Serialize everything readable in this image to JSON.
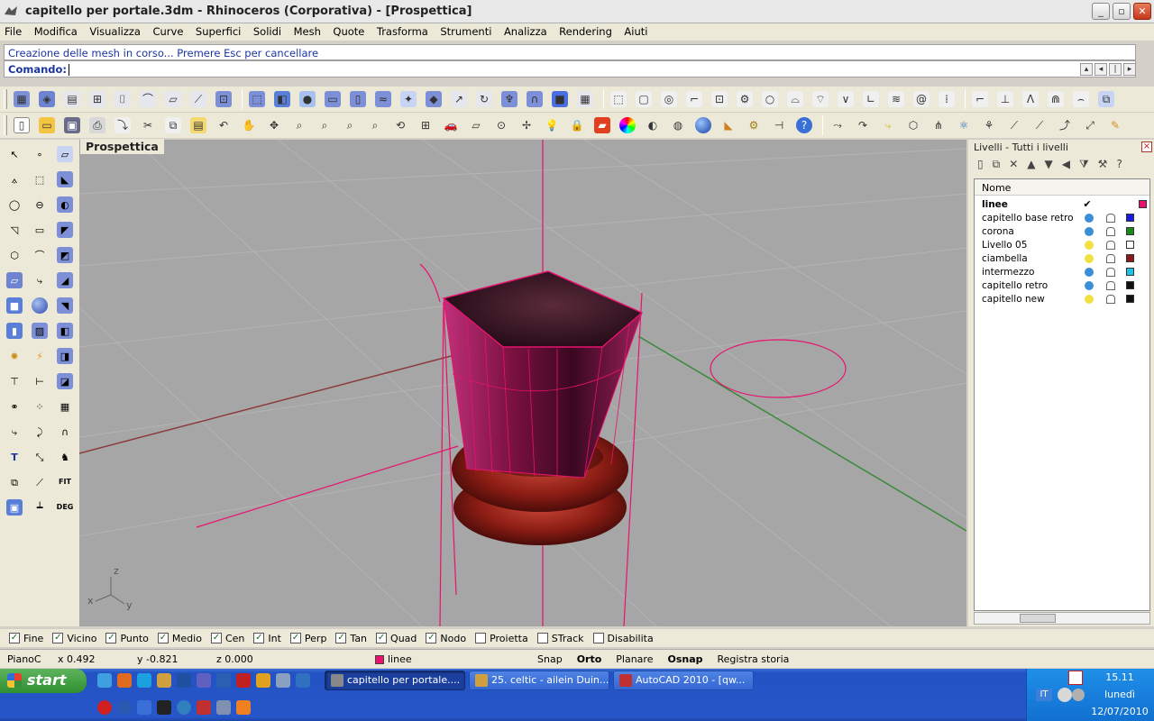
{
  "window": {
    "title": "capitello per portale.3dm - Rhinoceros (Corporativa) - [Prospettica]",
    "minimize": "_",
    "maximize": "▫",
    "close": "✕"
  },
  "menu": [
    "File",
    "Modifica",
    "Visualizza",
    "Curve",
    "Superfici",
    "Solidi",
    "Mesh",
    "Quote",
    "Trasforma",
    "Strumenti",
    "Analizza",
    "Rendering",
    "Aiuti"
  ],
  "command": {
    "history": "Creazione delle mesh in corso... Premere Esc per cancellare",
    "label": "Comando:",
    "value": ""
  },
  "viewport": {
    "title": "Prospettica",
    "axis_z": "z",
    "axis_x": "x",
    "axis_y": "y"
  },
  "layers_panel": {
    "title": "Livelli - Tutti i livelli",
    "column_name": "Nome",
    "layers": [
      {
        "name": "linee",
        "current": true,
        "visible": "",
        "color": "#e8126e"
      },
      {
        "name": "capitello base retro",
        "current": false,
        "bulb": "#3b8fd6",
        "color": "#1a1ae0"
      },
      {
        "name": "corona",
        "current": false,
        "bulb": "#3b8fd6",
        "color": "#1a8a1a"
      },
      {
        "name": "Livello 05",
        "current": false,
        "bulb": "#f0e040",
        "color": "#ffffff"
      },
      {
        "name": "ciambella",
        "current": false,
        "bulb": "#f0e040",
        "color": "#8a1a1a"
      },
      {
        "name": "intermezzo",
        "current": false,
        "bulb": "#3b8fd6",
        "color": "#20c0e8"
      },
      {
        "name": "capitello retro",
        "current": false,
        "bulb": "#3b8fd6",
        "color": "#111111"
      },
      {
        "name": "capitello new",
        "current": false,
        "bulb": "#f0e040",
        "color": "#111111"
      }
    ]
  },
  "osnap": [
    {
      "label": "Fine",
      "checked": true
    },
    {
      "label": "Vicino",
      "checked": true
    },
    {
      "label": "Punto",
      "checked": true
    },
    {
      "label": "Medio",
      "checked": true
    },
    {
      "label": "Cen",
      "checked": true
    },
    {
      "label": "Int",
      "checked": true
    },
    {
      "label": "Perp",
      "checked": true
    },
    {
      "label": "Tan",
      "checked": true
    },
    {
      "label": "Quad",
      "checked": true
    },
    {
      "label": "Nodo",
      "checked": true
    },
    {
      "label": "Proietta",
      "checked": false
    },
    {
      "label": "STrack",
      "checked": false
    },
    {
      "label": "Disabilita",
      "checked": false
    }
  ],
  "status": {
    "cplane": "PianoC",
    "x": "x 0.492",
    "y": "y -0.821",
    "z": "z 0.000",
    "layer": "linee",
    "snap": "Snap",
    "orto": "Orto",
    "planare": "Planare",
    "osnap": "Osnap",
    "history": "Registra storia"
  },
  "taskbar": {
    "start": "start",
    "tasks": [
      {
        "label": "capitello per portale....",
        "active": true
      },
      {
        "label": "25. celtic - ailein Duin...",
        "active": false
      },
      {
        "label": "AutoCAD 2010 - [qw...",
        "active": false
      }
    ],
    "lang": "IT",
    "time": "15.11",
    "day": "lunedì",
    "date": "12/07/2010"
  }
}
